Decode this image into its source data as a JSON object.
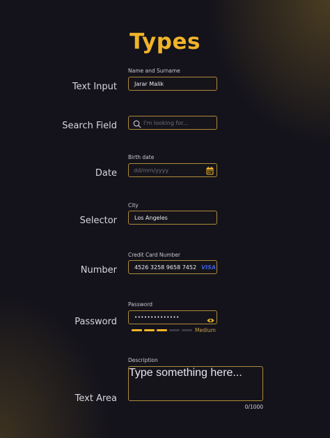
{
  "title": "Types",
  "text_input": {
    "row_label": "Text Input",
    "caption": "Name and Surname",
    "value": "Jarar Malik"
  },
  "search": {
    "row_label": "Search Field",
    "placeholder": "I'm looking for..."
  },
  "date": {
    "row_label": "Date",
    "caption": "Birth date",
    "placeholder": "dd/mm/yyyy"
  },
  "selector": {
    "row_label": "Selector",
    "caption": "City",
    "value": "Los Angeles"
  },
  "number": {
    "row_label": "Number",
    "caption": "Credit Card Number",
    "value": "4526 3258 9658 7452",
    "card_brand": "VISA"
  },
  "password": {
    "row_label": "Password",
    "caption": "Password",
    "value": "••••••••••••••",
    "strength_label": "Medium",
    "strength_level": 3,
    "strength_total": 5
  },
  "textarea": {
    "row_label": "Text Area",
    "caption": "Description",
    "placeholder": "Type something here...",
    "counter": "0/1000"
  },
  "colors": {
    "accent": "#f0b429",
    "border": "#b08a3a",
    "background": "#14131b",
    "visa": "#3d5bd6"
  },
  "icons": [
    "search-icon",
    "calendar-icon",
    "eye-icon"
  ]
}
